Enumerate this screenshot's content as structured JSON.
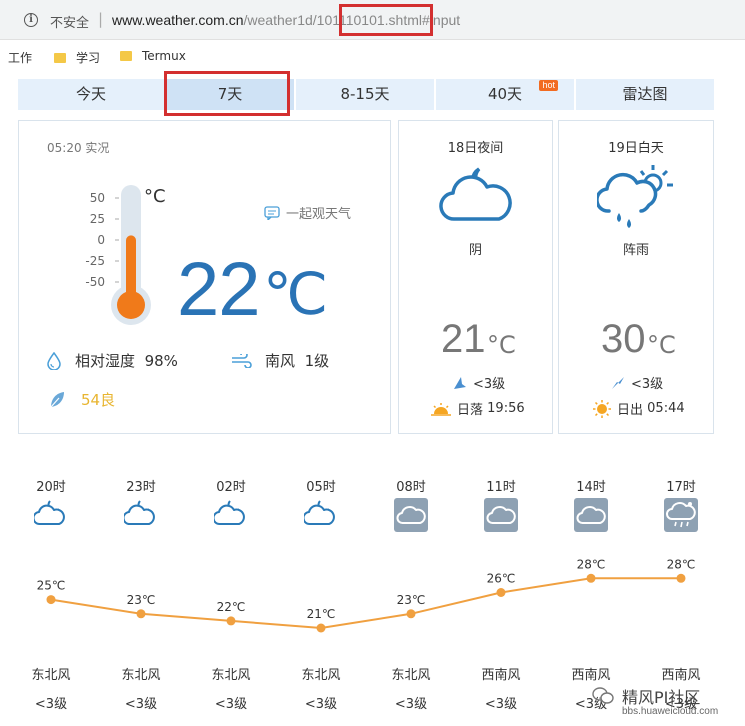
{
  "browser": {
    "security_label": "不安全",
    "url_host": "www.weather.com.cn",
    "url_path_a": "/weather1d/",
    "url_path_id": "101110101",
    "url_path_b": ".shtml#input"
  },
  "bookmarks": [
    {
      "label": "工作"
    },
    {
      "label": "学习"
    },
    {
      "label": "Termux"
    }
  ],
  "tabs": [
    {
      "label": "今天"
    },
    {
      "label": "7天"
    },
    {
      "label": "8-15天"
    },
    {
      "label": "40天",
      "badge": "hot"
    },
    {
      "label": "雷达图"
    }
  ],
  "now": {
    "time_label": "05:20 实况",
    "scale": [
      "50",
      "25",
      "0",
      "-25",
      "-50"
    ],
    "scale_unit": "°C",
    "watch_label": "一起观天气",
    "temp": "22",
    "unit": "℃",
    "humidity_label": "相对湿度",
    "humidity_value": "98%",
    "wind_label": "南风",
    "wind_level": "1级",
    "aqi": "54良",
    "therm_fill": 0.6
  },
  "night": {
    "title": "18日夜间",
    "weather": "阴",
    "temp": "21",
    "unit": "°C",
    "wind": "<3级",
    "sun_label": "日落",
    "sun_time": "19:56"
  },
  "day": {
    "title": "19日白天",
    "weather": "阵雨",
    "temp": "30",
    "unit": "°C",
    "wind": "<3级",
    "sun_label": "日出",
    "sun_time": "05:44"
  },
  "hourly": [
    {
      "hour": "20时",
      "icon": "moon-cloud-icon",
      "temp": "25℃",
      "temp_value": 25,
      "wind_dir": "东北风",
      "wind_level": "<3级"
    },
    {
      "hour": "23时",
      "icon": "moon-cloud-icon",
      "temp": "23℃",
      "temp_value": 23,
      "wind_dir": "东北风",
      "wind_level": "<3级"
    },
    {
      "hour": "02时",
      "icon": "moon-cloud-icon",
      "temp": "22℃",
      "temp_value": 22,
      "wind_dir": "东北风",
      "wind_level": "<3级"
    },
    {
      "hour": "05时",
      "icon": "moon-cloud-icon",
      "temp": "21℃",
      "temp_value": 21,
      "wind_dir": "东北风",
      "wind_level": "<3级"
    },
    {
      "hour": "08时",
      "icon": "overcast-icon",
      "temp": "23℃",
      "temp_value": 23,
      "wind_dir": "东北风",
      "wind_level": "<3级"
    },
    {
      "hour": "11时",
      "icon": "overcast-icon",
      "temp": "26℃",
      "temp_value": 26,
      "wind_dir": "西南风",
      "wind_level": "<3级"
    },
    {
      "hour": "14时",
      "icon": "overcast-icon",
      "temp": "28℃",
      "temp_value": 28,
      "wind_dir": "西南风",
      "wind_level": "<3级"
    },
    {
      "hour": "17时",
      "icon": "shower-icon",
      "temp": "28℃",
      "temp_value": 28,
      "wind_dir": "西南风",
      "wind_level": "<3级"
    }
  ],
  "watermark": {
    "name": "精风PI社区",
    "url": "bbs.huaweicloud.com"
  },
  "colors": {
    "accent": "#2a73b5",
    "curve": "#f0a040",
    "thermometer": "#f07a1a",
    "highlight_box": "#d32f2f"
  }
}
